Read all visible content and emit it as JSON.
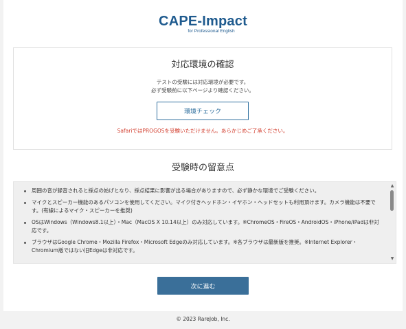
{
  "logo": {
    "title": "CAPE-Impact",
    "subtitle": "for Professional English"
  },
  "env_check": {
    "title": "対応環境の確認",
    "desc_line1": "テストの受験には対応環境が必要です。",
    "desc_line2": "必ず受験前に以下ページより確認ください。",
    "button_label": "環境チェック",
    "warning": "SafariではPROGOSを受験いただけません。あらかじめご了承ください。"
  },
  "notes": {
    "title": "受験時の留意点",
    "items": [
      "周囲の音が録音されると採点の妨げとなり、採点結果に影響が出る場合がありますので、必ず静かな環境でご受験ください。",
      "マイクとスピーカー機能のあるパソコンを使用してください。マイク付きヘッドホン・イヤホン・ヘッドセットも利用頂けます。カメラ機能は不要です。(有線によるマイク・スピーカーを推奨)",
      "OSはWindows（Windows8.1以上）・Mac（MacOS X 10.14以上）のみ対応しています。※ChromeOS・FireOS・AndroidOS・iPhone/iPadは非対応です。",
      "ブラウザはGoogle Chrome・Mozilla Firefox・Microsoft Edgeのみ対応しています。※各ブラウザは最新版を推奨。※Internet Explorer・Chromium版ではない旧Edgeは非対応です。"
    ]
  },
  "next_button": "次に進む",
  "footer": "© 2023 RareJob, Inc.",
  "colors": {
    "brand": "#1e5a8e",
    "primary_button": "#3a6f99",
    "warning": "#d23c2c"
  }
}
